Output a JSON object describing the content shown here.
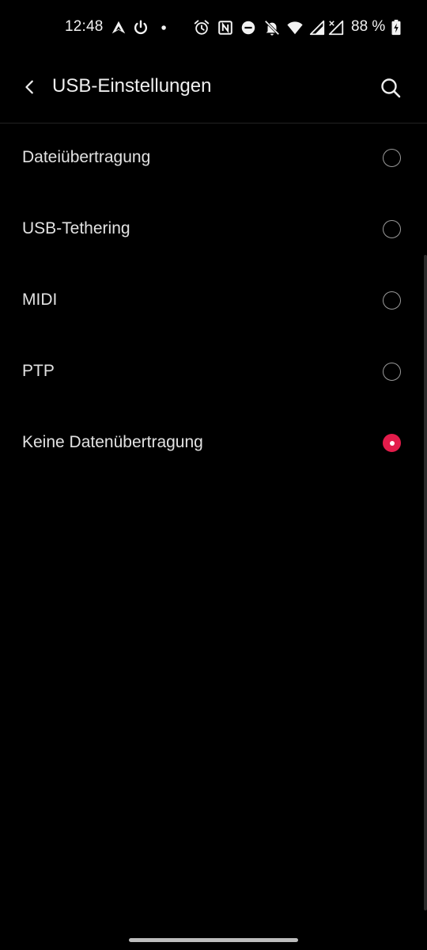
{
  "status_bar": {
    "time": "12:48",
    "battery_text": "88 %",
    "icons": [
      "arrow-up-icon",
      "power-icon",
      "notification-dot-icon",
      "alarm-icon",
      "nfc-icon",
      "do-not-disturb-icon",
      "notifications-off-icon",
      "wifi-icon",
      "signal-icon",
      "signal-no-data-icon",
      "battery-charging-icon"
    ]
  },
  "app_bar": {
    "title": "USB-Einstellungen",
    "back_icon": "chevron-left-icon",
    "search_icon": "search-icon"
  },
  "options": [
    {
      "label": "Dateiübertragung",
      "selected": false
    },
    {
      "label": "USB-Tethering",
      "selected": false
    },
    {
      "label": "MIDI",
      "selected": false
    },
    {
      "label": "PTP",
      "selected": false
    },
    {
      "label": "Keine Datenübertragung",
      "selected": true
    }
  ],
  "colors": {
    "background": "#000000",
    "accent": "#e31c4b",
    "text": "#e2e2e2",
    "radio_border": "#9a9a9a"
  }
}
